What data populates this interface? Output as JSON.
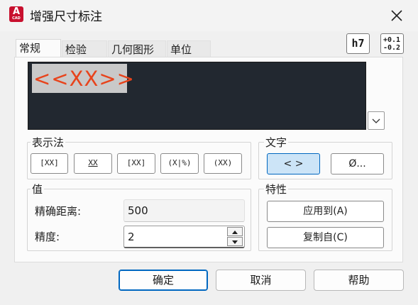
{
  "window": {
    "title": "增强尺寸标注",
    "app_icon_letter": "A",
    "app_icon_caption": "CAD",
    "close_icon": "close-icon"
  },
  "tabs": [
    {
      "label": "常规",
      "active": true
    },
    {
      "label": "检验",
      "active": false
    },
    {
      "label": "几何图形",
      "active": false
    },
    {
      "label": "单位",
      "active": false
    }
  ],
  "toolbar": {
    "fit_label": "h7",
    "tolerance_upper": "+0.1",
    "tolerance_lower": "-0.2"
  },
  "editor": {
    "content": "<<XX>>"
  },
  "representation": {
    "label": "表示法",
    "buttons": [
      "[XX]",
      "XX",
      "[XX]",
      "(X|%)",
      "(XX)"
    ]
  },
  "text": {
    "label": "文字",
    "brackets_label": "< >",
    "diameter_label": "Ø..."
  },
  "value": {
    "label": "值",
    "exact_distance_label": "精确距离:",
    "exact_distance_value": "500",
    "precision_label": "精度:",
    "precision_value": "2"
  },
  "properties": {
    "label": "特性",
    "apply_to_label": "应用到(A)",
    "copy_from_label": "复制自(C)"
  },
  "footer": {
    "ok_label": "确定",
    "cancel_label": "取消",
    "help_label": "帮助"
  },
  "colors": {
    "editor_bg": "#222830",
    "editor_text": "#e8431b",
    "accent": "#0067c0",
    "app_icon": "#c8102e"
  }
}
